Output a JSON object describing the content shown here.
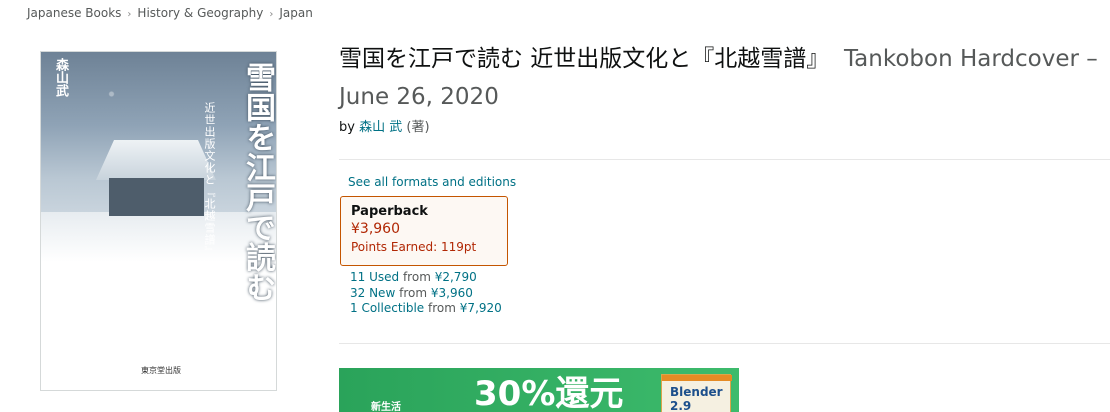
{
  "breadcrumb": [
    "Japanese Books",
    "History & Geography",
    "Japan"
  ],
  "product": {
    "title": "雪国を江戸で読む 近世出版文化と『北越雪譜』",
    "binding_date": "Tankobon Hardcover – June 26, 2020",
    "by_label": "by",
    "author": "森山 武",
    "author_role": "(著)"
  },
  "cover": {
    "title_text": "雪国を江戸で読む",
    "subtitle_text": "近世出版文化と『北越雪譜』",
    "author_text": "森山武",
    "publisher_text": "東京堂出版"
  },
  "formats": {
    "see_all_label": "See all formats and editions",
    "selected": {
      "format": "Paperback",
      "price": "¥3,960",
      "points": "Points Earned: 119pt"
    },
    "offers": [
      {
        "label": "11 Used",
        "from": "from",
        "price": "¥2,790"
      },
      {
        "label": "32 New",
        "from": "from",
        "price": "¥3,960"
      },
      {
        "label": "1 Collectible",
        "from": "from",
        "price": "¥7,920"
      }
    ]
  },
  "banner": {
    "small_text": "新生活",
    "big_text": "30%還元",
    "thumb_text": "Blender 2.9"
  },
  "colors": {
    "link": "#007185",
    "price": "#b12704",
    "swatch_border": "#c45500",
    "banner_green": "#2aa35a"
  }
}
